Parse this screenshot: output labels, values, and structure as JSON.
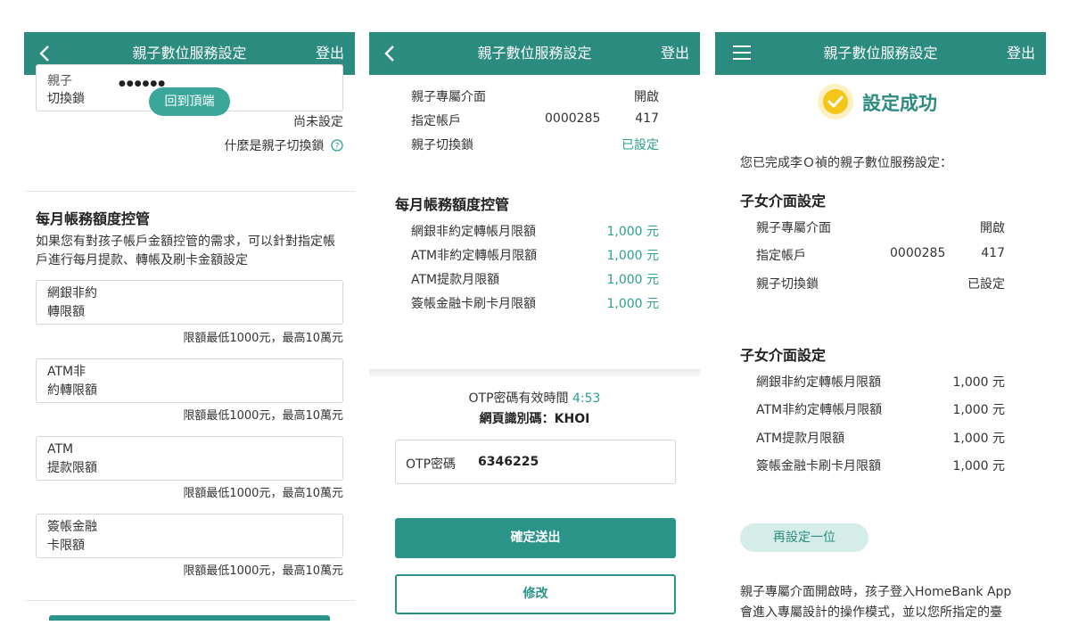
{
  "screens": [
    {
      "header": {
        "title": "親子數位服務設定",
        "logout": "登出"
      },
      "top_field": {
        "label_line1": "親子",
        "label_line2": "切換鎖",
        "value": "●●●●●●"
      },
      "back_to_top": "回到頂端",
      "not_set": "尚未設定",
      "what_is_link": "什麼是親子切換鎖",
      "section_title": "每月帳務額度控管",
      "section_desc_line1": "如果您有對孩子帳戶金額控管的需求，可以針對指定帳",
      "section_desc_line2": "戶進行每月提款、轉帳及刷卡金額設定",
      "fields": [
        {
          "line1": "網銀非約",
          "line2": "轉限額",
          "hint": "限額最低1000元，最高10萬元"
        },
        {
          "line1": "ATM非",
          "line2": "約轉限額",
          "hint": "限額最低1000元，最高10萬元"
        },
        {
          "line1": "ATM",
          "line2": "提款限額",
          "hint": "限額最低1000元，最高10萬元"
        },
        {
          "line1": "簽帳金融",
          "line2": "卡限額",
          "hint": "限額最低1000元，最高10萬元"
        }
      ]
    },
    {
      "header": {
        "title": "親子數位服務設定",
        "logout": "登出"
      },
      "rows": [
        {
          "label": "親子專屬介面",
          "value": "開啟"
        },
        {
          "label": "指定帳戶",
          "account": "0000285",
          "value": "417"
        },
        {
          "label": "親子切換鎖",
          "value": "已設定"
        }
      ],
      "limits_title": "每月帳務額度控管",
      "limits": [
        {
          "label": "網銀非約定轉帳月限額",
          "value": "1,000 元"
        },
        {
          "label": "ATM非約定轉帳月限額",
          "value": "1,000 元"
        },
        {
          "label": "ATM提款月限額",
          "value": "1,000 元"
        },
        {
          "label": "簽帳金融卡刷卡月限額",
          "value": "1,000 元"
        }
      ],
      "otp_valid_label": "OTP密碼有效時間",
      "otp_time": "4:53",
      "page_code": "網頁識別碼：KHOI",
      "otp_field_label": "OTP密碼",
      "otp_value": "6346225",
      "submit": "確定送出",
      "modify": "修改"
    },
    {
      "header": {
        "title": "親子數位服務設定",
        "logout": "登出"
      },
      "success_title": "設定成功",
      "intro": "您已完成李Ｏ禎的親子數位服務設定：",
      "section1_title": "子女介面設定",
      "rows": [
        {
          "label": "親子專屬介面",
          "value": "開啟"
        },
        {
          "label": "指定帳戶",
          "account": "0000285",
          "value": "417"
        },
        {
          "label": "親子切換鎖",
          "value": "已設定"
        }
      ],
      "section2_title": "子女介面設定",
      "limits": [
        {
          "label": "網銀非約定轉帳月限額",
          "value": "1,000 元"
        },
        {
          "label": "ATM非約定轉帳月限額",
          "value": "1,000 元"
        },
        {
          "label": "ATM提款月限額",
          "value": "1,000 元"
        },
        {
          "label": "簽帳金融卡刷卡月限額",
          "value": "1,000 元"
        }
      ],
      "again_button": "再設定一位",
      "footer_line1": "親子專屬介面開啟時，孩子登入HomeBank App",
      "footer_line2": "會進入專屬設計的操作模式，並以您所指定的臺"
    }
  ],
  "colors": {
    "header": "#2b8b7f",
    "accent": "#2b9f91",
    "success_icon": "#f5c518",
    "pill_bg": "#d5ede9"
  }
}
